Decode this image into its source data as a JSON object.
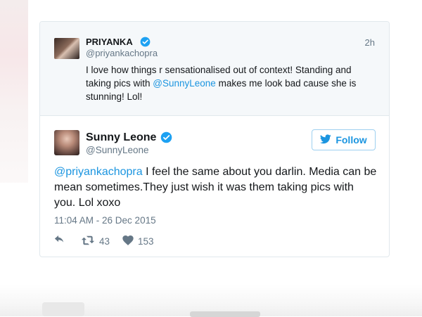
{
  "quoted": {
    "name": "PRIYANKA",
    "handle": "@priyankachopra",
    "time": "2h",
    "text_before": "I love how things r sensationalised out of context! Standing and taking pics with ",
    "mention": "@SunnyLeone",
    "text_after": " makes me look bad cause she is stunning! Lol!"
  },
  "main": {
    "name": "Sunny Leone",
    "handle": "@SunnyLeone",
    "follow_label": "Follow",
    "mention": "@priyankachopra",
    "text": " I feel the same about you darlin. Media can be mean sometimes.They just wish it was them taking pics with you. Lol xoxo",
    "date": "11:04 AM - 26 Dec 2015",
    "retweets": "43",
    "likes": "153"
  },
  "colors": {
    "link": "#1b95e0",
    "muted": "#657786",
    "verified": "#1da1f2"
  },
  "icons": [
    "verified-badge-icon",
    "twitter-bird-icon",
    "reply-icon",
    "retweet-icon",
    "heart-icon"
  ]
}
